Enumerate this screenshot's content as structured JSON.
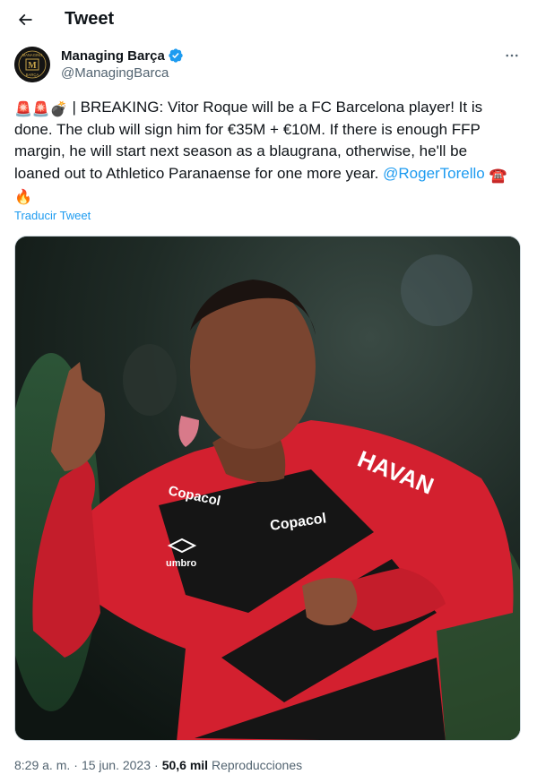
{
  "header": {
    "title": "Tweet",
    "back_icon": "arrow-left-icon"
  },
  "author": {
    "display_name": "Managing Barça",
    "handle": "@ManagingBarca",
    "verified_icon": "verified-badge-icon",
    "verified_color": "#1d9bf0",
    "avatar_lines": [
      "MANAGING",
      "BARÇA"
    ],
    "avatar_initial": "M"
  },
  "tweet": {
    "emoji_prefix": "🚨🚨💣",
    "text_main": "| BREAKING: Vitor Roque will be a FC Barcelona player! It is done. The club will sign him for €35M + €10M. If there is enough FFP margin, he will start next season as a blaugrana, otherwise, he'll be loaned out to Athletico Paranaense for one more year.",
    "mention": "@RogerTorello",
    "emoji_suffix": "☎️",
    "emoji_end": "🔥"
  },
  "translate_label": "Traducir Tweet",
  "media": {
    "jersey_text_havan": "HAVAN",
    "jersey_text_copacol_1": "Copacol",
    "jersey_text_copacol_2": "Copacol",
    "jersey_text_umbro": "umbro"
  },
  "meta": {
    "time": "8:29 a. m.",
    "date": "15 jun. 2023",
    "views_count": "50,6 mil",
    "views_label": "Reproducciones",
    "separator": "·"
  },
  "colors": {
    "link": "#1d9bf0",
    "text_primary": "#0f1419",
    "text_secondary": "#536471",
    "jersey_red": "#d3202f",
    "jersey_black": "#151515"
  }
}
